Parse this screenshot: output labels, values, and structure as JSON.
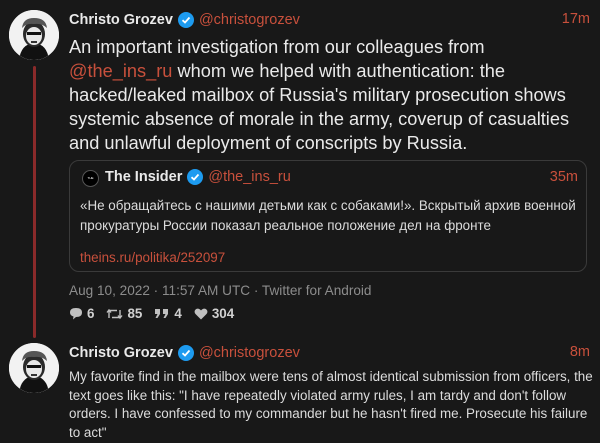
{
  "tweet1": {
    "name": "Christo Grozev",
    "handle": "@christogrozev",
    "time": "17m",
    "text_before": "An important investigation from our colleagues from ",
    "mention": "@the_ins_ru",
    "text_after": " whom we helped with authentication: the hacked/leaked mailbox of Russia's military prosecution shows systemic absence of morale in the army, coverup of casualties and unlawful deployment of conscripts by Russia.",
    "quote": {
      "logo_text": "THE INSIDER",
      "name": "The Insider",
      "handle": "@the_ins_ru",
      "time": "35m",
      "text": "«Не обращайтесь с нашими детьми как с собаками!». Вскрытый архив военной прокуратуры России показал реальное положение дел на фронте",
      "link": "theins.ru/politika/252097"
    },
    "meta": "Aug 10, 2022 · 11:57 AM UTC · Twitter for Android",
    "stats": {
      "replies": "6",
      "retweets": "85",
      "quotes": "4",
      "likes": "304"
    }
  },
  "tweet2": {
    "name": "Christo Grozev",
    "handle": "@christogrozev",
    "time": "8m",
    "text": "My favorite find in the mailbox were tens of almost identical submission from officers, the text goes like this: \"I have repeatedly violated army rules, I am tardy and don't follow orders. I have confessed to my commander but he hasn't fired me. Prosecute his failure to act\""
  },
  "colors": {
    "background": "#181818",
    "accent": "#c8503c",
    "verified": "#1d9bf0",
    "thread_line": "#8a2a2a"
  },
  "icons": [
    "verified-badge-icon",
    "reply-icon",
    "retweet-icon",
    "quote-icon",
    "heart-icon"
  ]
}
